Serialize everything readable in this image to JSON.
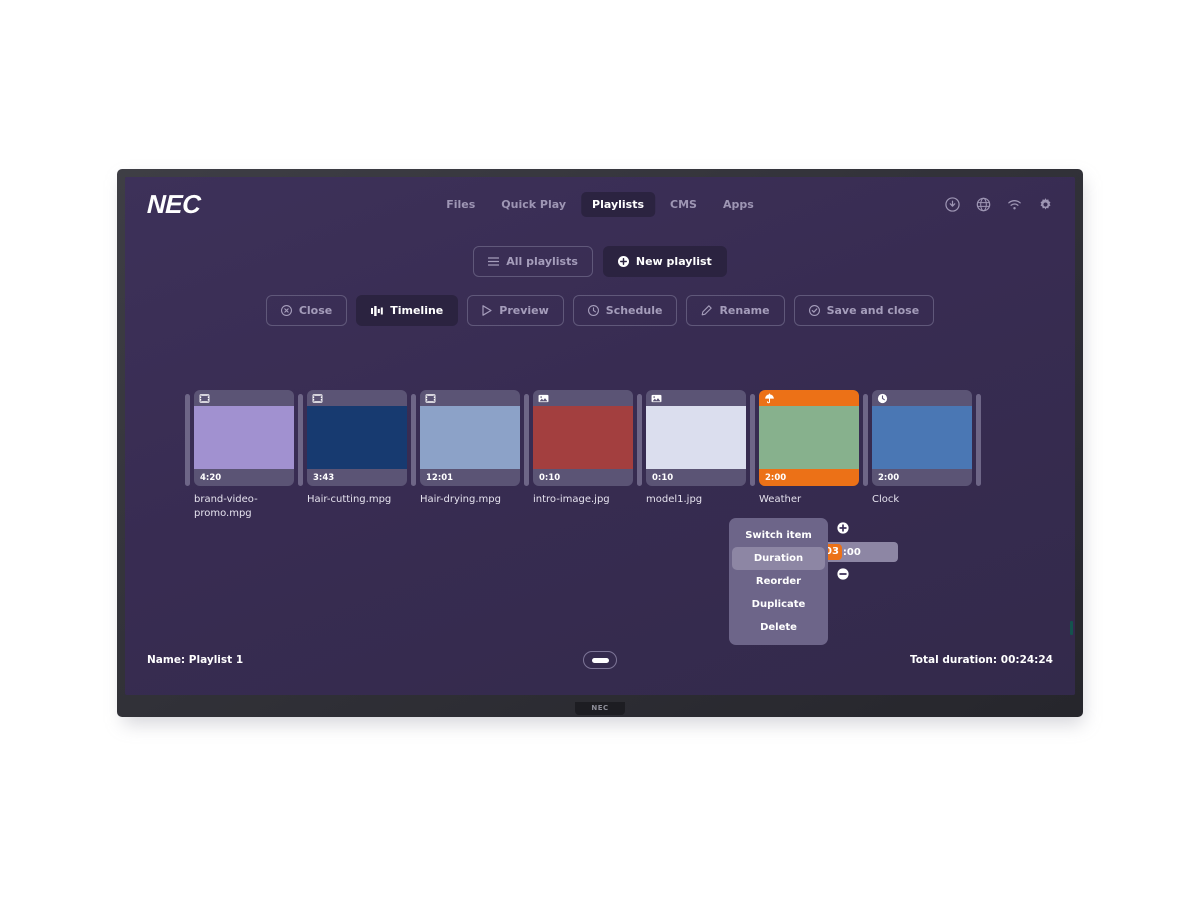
{
  "device": {
    "brand_logo": "NEC",
    "bezel_logo": "NEC"
  },
  "header": {
    "logo": "NEC",
    "nav": [
      {
        "label": "Files",
        "active": false
      },
      {
        "label": "Quick Play",
        "active": false
      },
      {
        "label": "Playlists",
        "active": true
      },
      {
        "label": "CMS",
        "active": false
      },
      {
        "label": "Apps",
        "active": false
      }
    ],
    "icons": [
      {
        "name": "download-icon"
      },
      {
        "name": "globe-icon"
      },
      {
        "name": "wifi-icon"
      },
      {
        "name": "gear-icon"
      }
    ]
  },
  "toolbar_primary": [
    {
      "label": "All playlists",
      "icon": "hamburger-icon",
      "style": "outline"
    },
    {
      "label": "New playlist",
      "icon": "plus-circle-icon",
      "style": "solid"
    }
  ],
  "toolbar_secondary": [
    {
      "label": "Close",
      "icon": "close-circle-icon",
      "active": false
    },
    {
      "label": "Timeline",
      "icon": "timeline-icon",
      "active": true
    },
    {
      "label": "Preview",
      "icon": "play-icon",
      "active": false
    },
    {
      "label": "Schedule",
      "icon": "clock-icon",
      "active": false
    },
    {
      "label": "Rename",
      "icon": "pencil-icon",
      "active": false
    },
    {
      "label": "Save and close",
      "icon": "check-circle-icon",
      "active": false
    }
  ],
  "timeline": {
    "items": [
      {
        "name": "brand-video-promo.mpg",
        "duration": "4:20",
        "icon": "film-icon",
        "selected": false,
        "tile_color": "#5b5475",
        "media_color": "#a191d0"
      },
      {
        "name": "Hair-cutting.mpg",
        "duration": "3:43",
        "icon": "film-icon",
        "selected": false,
        "tile_color": "#5b5475",
        "media_color": "#173a70"
      },
      {
        "name": "Hair-drying.mpg",
        "duration": "12:01",
        "icon": "film-icon",
        "selected": false,
        "tile_color": "#5b5475",
        "media_color": "#8ca2c8"
      },
      {
        "name": "intro-image.jpg",
        "duration": "0:10",
        "icon": "image-icon",
        "selected": false,
        "tile_color": "#5b5475",
        "media_color": "#a33f3f"
      },
      {
        "name": "model1.jpg",
        "duration": "0:10",
        "icon": "image-icon",
        "selected": false,
        "tile_color": "#5b5475",
        "media_color": "#dbdeee"
      },
      {
        "name": "Weather",
        "duration": "2:00",
        "icon": "umbrella-icon",
        "selected": true,
        "tile_color": "#ec7117",
        "media_color": "#87b18d"
      },
      {
        "name": "Clock",
        "duration": "2:00",
        "icon": "clock-filled-icon",
        "selected": false,
        "tile_color": "#5b5475",
        "media_color": "#4a77b4"
      }
    ]
  },
  "context_menu": {
    "items": [
      {
        "label": "Switch item",
        "active": false
      },
      {
        "label": "Duration",
        "active": true
      },
      {
        "label": "Reorder",
        "active": false
      },
      {
        "label": "Duplicate",
        "active": false
      },
      {
        "label": "Delete",
        "active": false
      }
    ],
    "duration_value_highlight": "03",
    "duration_value_rest": ":00",
    "increase_icon": "plus-circle-icon",
    "decrease_icon": "minus-circle-icon"
  },
  "footer": {
    "name_label": "Name: Playlist 1",
    "total_duration_label": "Total duration: 00:24:24",
    "home_button": "home-pill-button"
  },
  "colors": {
    "accent": "#ec7117",
    "screen_bg": "#382c52",
    "tile_bg": "#5b5475",
    "nav_active_bg": "#2b2340"
  }
}
